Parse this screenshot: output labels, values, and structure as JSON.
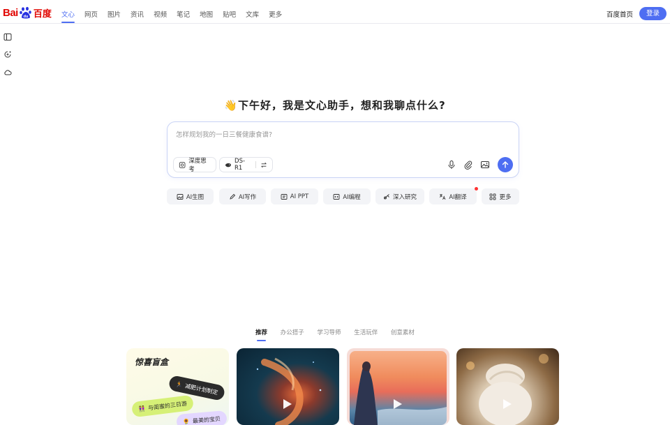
{
  "logo": {
    "bai": "Bai",
    "du": "du",
    "cn": "百度"
  },
  "nav": {
    "tabs": [
      {
        "label": "文心",
        "active": true
      },
      {
        "label": "网页"
      },
      {
        "label": "图片"
      },
      {
        "label": "资讯"
      },
      {
        "label": "视频"
      },
      {
        "label": "笔记"
      },
      {
        "label": "地图"
      },
      {
        "label": "贴吧"
      },
      {
        "label": "文库"
      },
      {
        "label": "更多"
      }
    ],
    "home_link": "百度首页",
    "login": "登录"
  },
  "greeting": "👋下午好，我是文心助手，想和我聊点什么?",
  "chat": {
    "placeholder": "怎样规划我的一日三餐健康食谱?",
    "deep_think": "深度思考",
    "model": "DS-R1"
  },
  "quick_actions": [
    "AI生图",
    "AI写作",
    "AI PPT",
    "AI编程",
    "深入研究",
    "AI翻译",
    "更多"
  ],
  "categories": [
    {
      "label": "推荐",
      "active": true
    },
    {
      "label": "办公搭子"
    },
    {
      "label": "学习导师"
    },
    {
      "label": "生活玩伴"
    },
    {
      "label": "创意素材"
    }
  ],
  "cards": {
    "surprise_title": "惊喜盲盒",
    "tags": [
      "减肥计划制定",
      "与闺蜜的三日游",
      "最美的宝贝"
    ]
  },
  "colors": {
    "accent": "#4e6ef2",
    "brand_red": "#e10602"
  }
}
